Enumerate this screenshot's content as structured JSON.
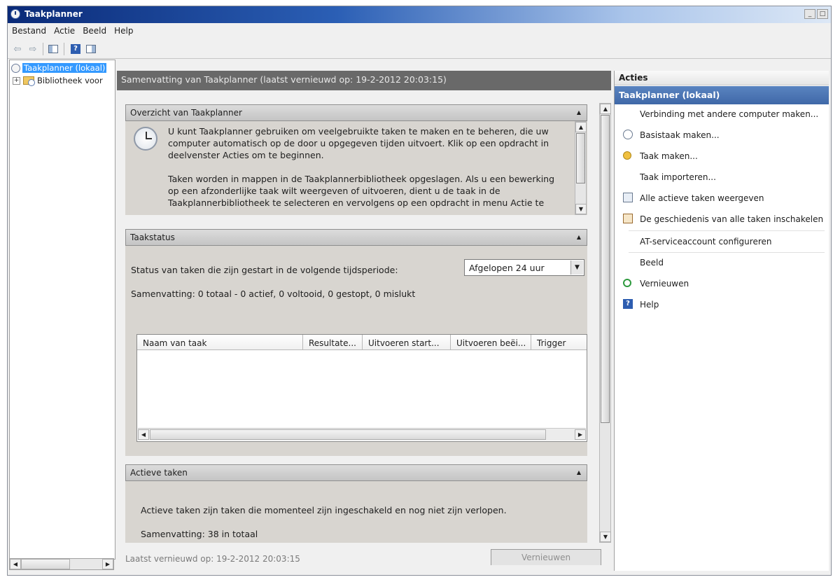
{
  "window": {
    "title": "Taakplanner",
    "controls": [
      "_",
      "□"
    ]
  },
  "menu": [
    "Bestand",
    "Actie",
    "Beeld",
    "Help"
  ],
  "toolbar": {
    "back": "⇦",
    "forward": "⇨",
    "help": "?"
  },
  "nav_tree": {
    "root": "Taakplanner (lokaal)",
    "child_expander": "+",
    "child": "Bibliotheek voor"
  },
  "center": {
    "header": "Samenvatting van Taakplanner (laatst vernieuwd op: 19-2-2012 20:03:15)",
    "overview": {
      "title": "Overzicht van Taakplanner",
      "para1": "U kunt Taakplanner gebruiken om veelgebruikte taken te maken en te beheren, die uw computer automatisch op de door u opgegeven tijden uitvoert. Klik op een opdracht in deelvenster Acties om te beginnen.",
      "para2": "Taken worden in mappen in de Taakplannerbibliotheek opgeslagen. Als u een bewerking op een afzonderlijke taak wilt weergeven of uitvoeren, dient u de taak in de Taakplannerbibliotheek te selecteren en vervolgens op een opdracht in menu Actie te"
    },
    "taskstatus": {
      "title": "Taakstatus",
      "period_label": "Status van taken die zijn gestart in de volgende tijdsperiode:",
      "period_value": "Afgelopen 24 uur",
      "summary": "Samenvatting: 0 totaal - 0 actief, 0 voltooid, 0 gestopt, 0 mislukt",
      "columns": [
        "Naam van taak",
        "Resultate...",
        "Uitvoeren start...",
        "Uitvoeren beëi...",
        "Trigger"
      ]
    },
    "active": {
      "title": "Actieve taken",
      "description": "Actieve taken zijn taken die momenteel zijn ingeschakeld en nog niet zijn verlopen.",
      "summary": "Samenvatting: 38 in totaal"
    },
    "footer": {
      "last_refreshed": "Laatst vernieuwd op: 19-2-2012 20:03:15",
      "refresh_button": "Vernieuwen"
    }
  },
  "actions": {
    "title": "Acties",
    "group": "Taakplanner (lokaal)",
    "items": [
      {
        "label": "Verbinding met andere computer maken...",
        "icon": ""
      },
      {
        "label": "Basistaak maken...",
        "icon": "basic-task-icon"
      },
      {
        "label": "Taak maken...",
        "icon": "create-task-icon"
      },
      {
        "label": "Taak importeren...",
        "icon": ""
      },
      {
        "label": "Alle actieve taken weergeven",
        "icon": "running-tasks-icon"
      },
      {
        "label": "De geschiedenis van alle taken inschakelen",
        "icon": "history-icon"
      },
      {
        "label": "AT-serviceaccount configureren",
        "icon": ""
      },
      {
        "label": "Beeld",
        "icon": ""
      },
      {
        "label": "Vernieuwen",
        "icon": "refresh-icon"
      },
      {
        "label": "Help",
        "icon": "help-icon"
      }
    ]
  },
  "colors": {
    "accent": "#3f68a8",
    "header_gray": "#696969",
    "selection": "#3399ff"
  }
}
